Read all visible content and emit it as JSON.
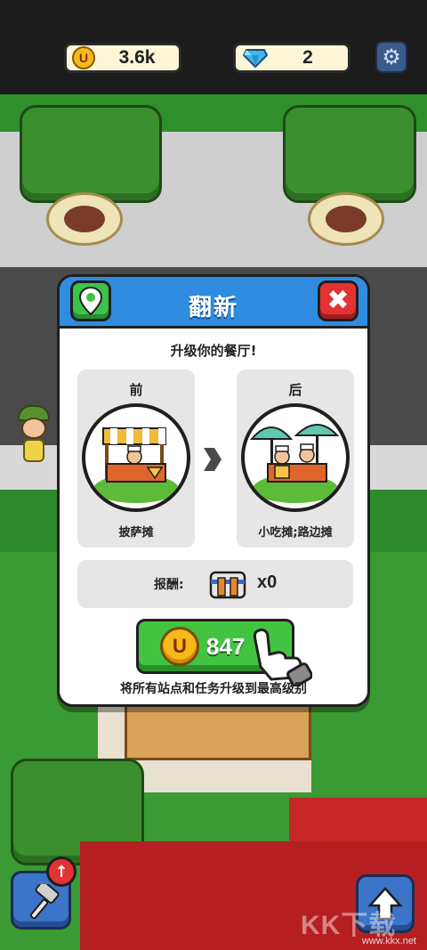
{
  "hud": {
    "coins": "3.6k",
    "gems": "2",
    "coin_glyph": "U",
    "icons": [
      "coin-icon",
      "gem-icon",
      "gear-icon"
    ]
  },
  "dialog": {
    "title": "翻新",
    "subtitle": "升级你的餐厅!",
    "before": {
      "header": "前",
      "name": "披萨摊"
    },
    "after": {
      "header": "后",
      "name": "小吃摊;路边摊"
    },
    "reward": {
      "label": "报酬:",
      "count": "x0"
    },
    "upgrade": {
      "cost": "847",
      "coin_glyph": "U"
    },
    "footer": "将所有站点和任务升级到最高级别"
  },
  "bottom": {
    "badge": "↑",
    "watermark": "www.kkx.net",
    "logo_text": "KK下载"
  },
  "colors": {
    "header_blue": "#2f8ce0",
    "close_red": "#e23232",
    "map_green": "#3ec34a",
    "upgrade_green": "#43c441",
    "coin_gold": "#f6b91c"
  }
}
